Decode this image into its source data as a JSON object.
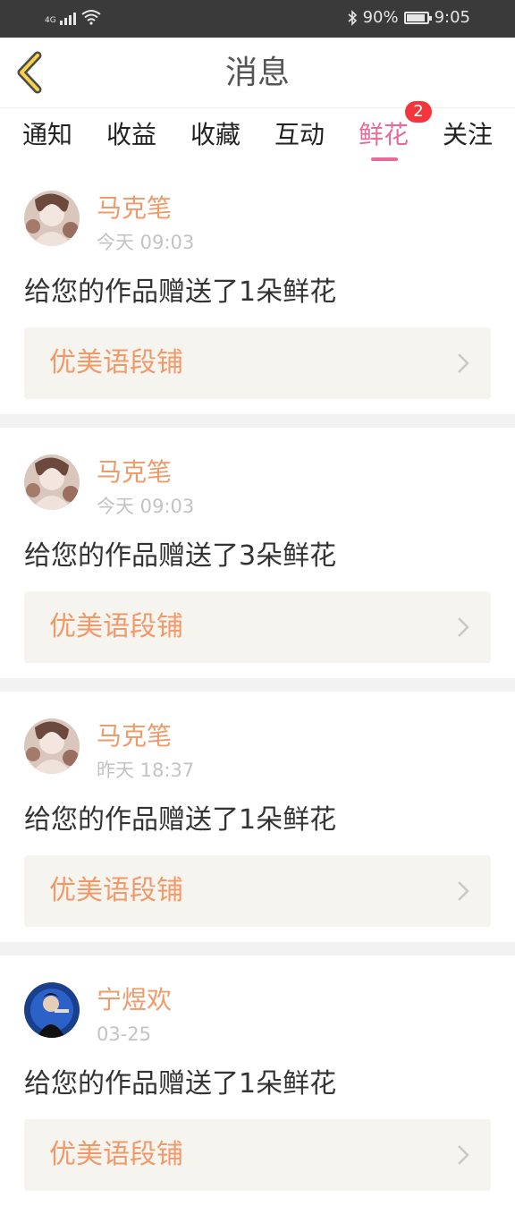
{
  "status_bar": {
    "network": "4G",
    "battery": "90%",
    "battery_level": 0.9,
    "time": "9:05"
  },
  "header": {
    "title": "消息"
  },
  "tabs": [
    {
      "label": "通知"
    },
    {
      "label": "收益"
    },
    {
      "label": "收藏"
    },
    {
      "label": "互动"
    },
    {
      "label": "鲜花",
      "badge": "2",
      "active": true
    },
    {
      "label": "关注"
    }
  ],
  "items": [
    {
      "name": "马克笔",
      "time": "今天 09:03",
      "message": "给您的作品赠送了1朵鲜花",
      "work": "优美语段铺"
    },
    {
      "name": "马克笔",
      "time": "今天 09:03",
      "message": "给您的作品赠送了3朵鲜花",
      "work": "优美语段铺"
    },
    {
      "name": "马克笔",
      "time": "昨天 18:37",
      "message": "给您的作品赠送了1朵鲜花",
      "work": "优美语段铺"
    },
    {
      "name": "宁煜欢",
      "time": "03-25",
      "message": "给您的作品赠送了1朵鲜花",
      "work": "优美语段铺"
    }
  ],
  "colors": {
    "accent": "#e86a98",
    "name": "#f09a6a",
    "badge": "#f2363b"
  }
}
